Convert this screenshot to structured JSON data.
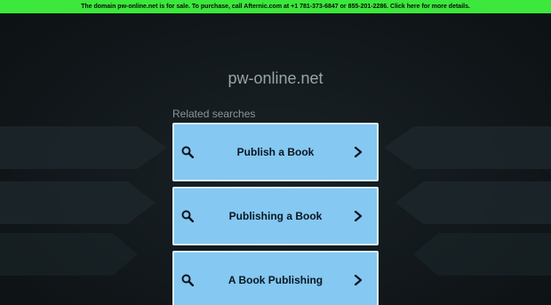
{
  "banner": {
    "text": "The domain pw-online.net is for sale. To purchase, call Afternic.com at +1 781-373-6847 or 855-201-2286. Click here for more details."
  },
  "domain_title": "pw-online.net",
  "related": {
    "label": "Related searches",
    "items": [
      {
        "label": "Publish a Book",
        "icon": "search-icon",
        "arrow": "chevron-right-icon"
      },
      {
        "label": "Publishing a Book",
        "icon": "search-icon",
        "arrow": "chevron-right-icon"
      },
      {
        "label": "A Book Publishing",
        "icon": "search-icon",
        "arrow": "chevron-right-icon"
      }
    ]
  },
  "colors": {
    "banner_bg": "#3be83b",
    "card_bg": "#85c8f2",
    "page_bg": "#0f1417"
  }
}
